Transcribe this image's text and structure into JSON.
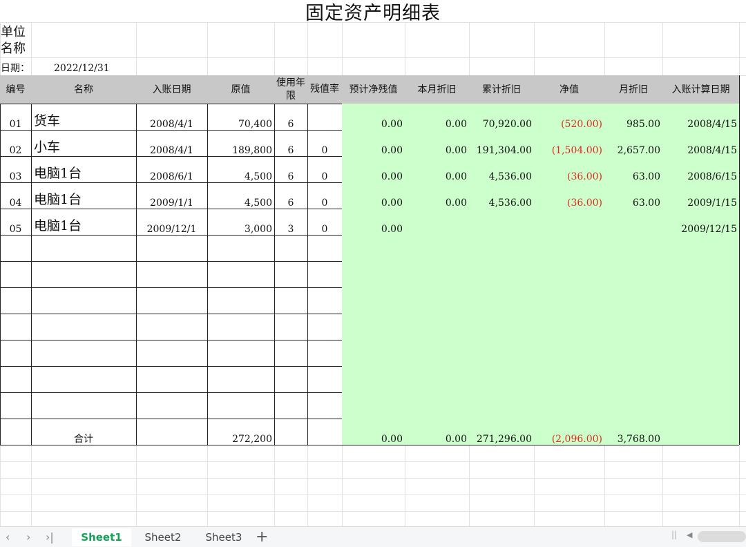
{
  "title": "固定资产明细表",
  "unit_label": "单位名称",
  "date_label": "日期：",
  "date_value": "2022/12/31",
  "headers": [
    "编号",
    "名称",
    "入账日期",
    "原值",
    "使用年限",
    "残值率",
    "预计净残值",
    "本月折旧",
    "累计折旧",
    "净值",
    "月折旧",
    "入账计算日期"
  ],
  "rows": [
    {
      "id": "01",
      "name": "货车",
      "date": "2008/4/1",
      "orig": "70,400",
      "life": "6",
      "rate": "",
      "salvage": "0.00",
      "monthly_dep": "0.00",
      "accum_dep": "70,920.00",
      "net": "(520.00)",
      "month_dep": "985.00",
      "calc_date": "2008/4/15"
    },
    {
      "id": "02",
      "name": "小车",
      "date": "2008/4/1",
      "orig": "189,800",
      "life": "6",
      "rate": "0",
      "salvage": "0.00",
      "monthly_dep": "0.00",
      "accum_dep": "191,304.00",
      "net": "(1,504.00)",
      "month_dep": "2,657.00",
      "calc_date": "2008/4/15"
    },
    {
      "id": "03",
      "name": "电脑1台",
      "date": "2008/6/1",
      "orig": "4,500",
      "life": "6",
      "rate": "0",
      "salvage": "0.00",
      "monthly_dep": "0.00",
      "accum_dep": "4,536.00",
      "net": "(36.00)",
      "month_dep": "63.00",
      "calc_date": "2008/6/15"
    },
    {
      "id": "04",
      "name": "电脑1台",
      "date": "2009/1/1",
      "orig": "4,500",
      "life": "6",
      "rate": "0",
      "salvage": "0.00",
      "monthly_dep": "0.00",
      "accum_dep": "4,536.00",
      "net": "(36.00)",
      "month_dep": "63.00",
      "calc_date": "2009/1/15"
    },
    {
      "id": "05",
      "name": "电脑1台",
      "date": "2009/12/1",
      "orig": "3,000",
      "life": "3",
      "rate": "0",
      "salvage": "0.00",
      "monthly_dep": "",
      "accum_dep": "",
      "net": "",
      "month_dep": "",
      "calc_date": "2009/12/15"
    }
  ],
  "total": {
    "label": "合计",
    "orig": "272,200",
    "salvage": "0.00",
    "monthly_dep": "0.00",
    "accum_dep": "271,296.00",
    "net": "(2,096.00)",
    "month_dep": "3,768.00"
  },
  "sheet_tabs": [
    "Sheet1",
    "Sheet2",
    "Sheet3"
  ],
  "active_tab": "Sheet1",
  "nav_icons": [
    "prev-sheet-icon",
    "next-sheet-icon",
    "last-sheet-icon",
    "add-sheet-icon"
  ],
  "colors": {
    "header_bg": "#c8c8c8",
    "computed_bg": "#ccffcc",
    "negative": "#e0281d",
    "active_tab": "#15a05a"
  }
}
